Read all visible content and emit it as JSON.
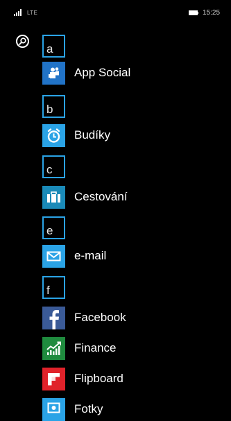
{
  "status_bar": {
    "network": "LTE",
    "time": "15:25"
  },
  "search": {
    "icon": "search-icon"
  },
  "colors": {
    "accent": "#2aa3e6",
    "background": "#000000",
    "finance": "#1f8b3e",
    "flipboard": "#e0222a",
    "facebook": "#3a5a97"
  },
  "groups": [
    {
      "letter": "a",
      "apps": [
        {
          "label": "App Social",
          "icon": "app-social-icon"
        }
      ]
    },
    {
      "letter": "b",
      "apps": [
        {
          "label": "Budíky",
          "icon": "alarm-clock-icon"
        }
      ]
    },
    {
      "letter": "c",
      "apps": [
        {
          "label": "Cestování",
          "icon": "suitcase-icon"
        }
      ]
    },
    {
      "letter": "e",
      "apps": [
        {
          "label": "e-mail",
          "icon": "envelope-icon"
        }
      ]
    },
    {
      "letter": "f",
      "apps": [
        {
          "label": "Facebook",
          "icon": "facebook-icon"
        },
        {
          "label": "Finance",
          "icon": "finance-chart-icon"
        },
        {
          "label": "Flipboard",
          "icon": "flipboard-icon"
        },
        {
          "label": "Fotky",
          "icon": "photos-icon"
        }
      ]
    }
  ]
}
